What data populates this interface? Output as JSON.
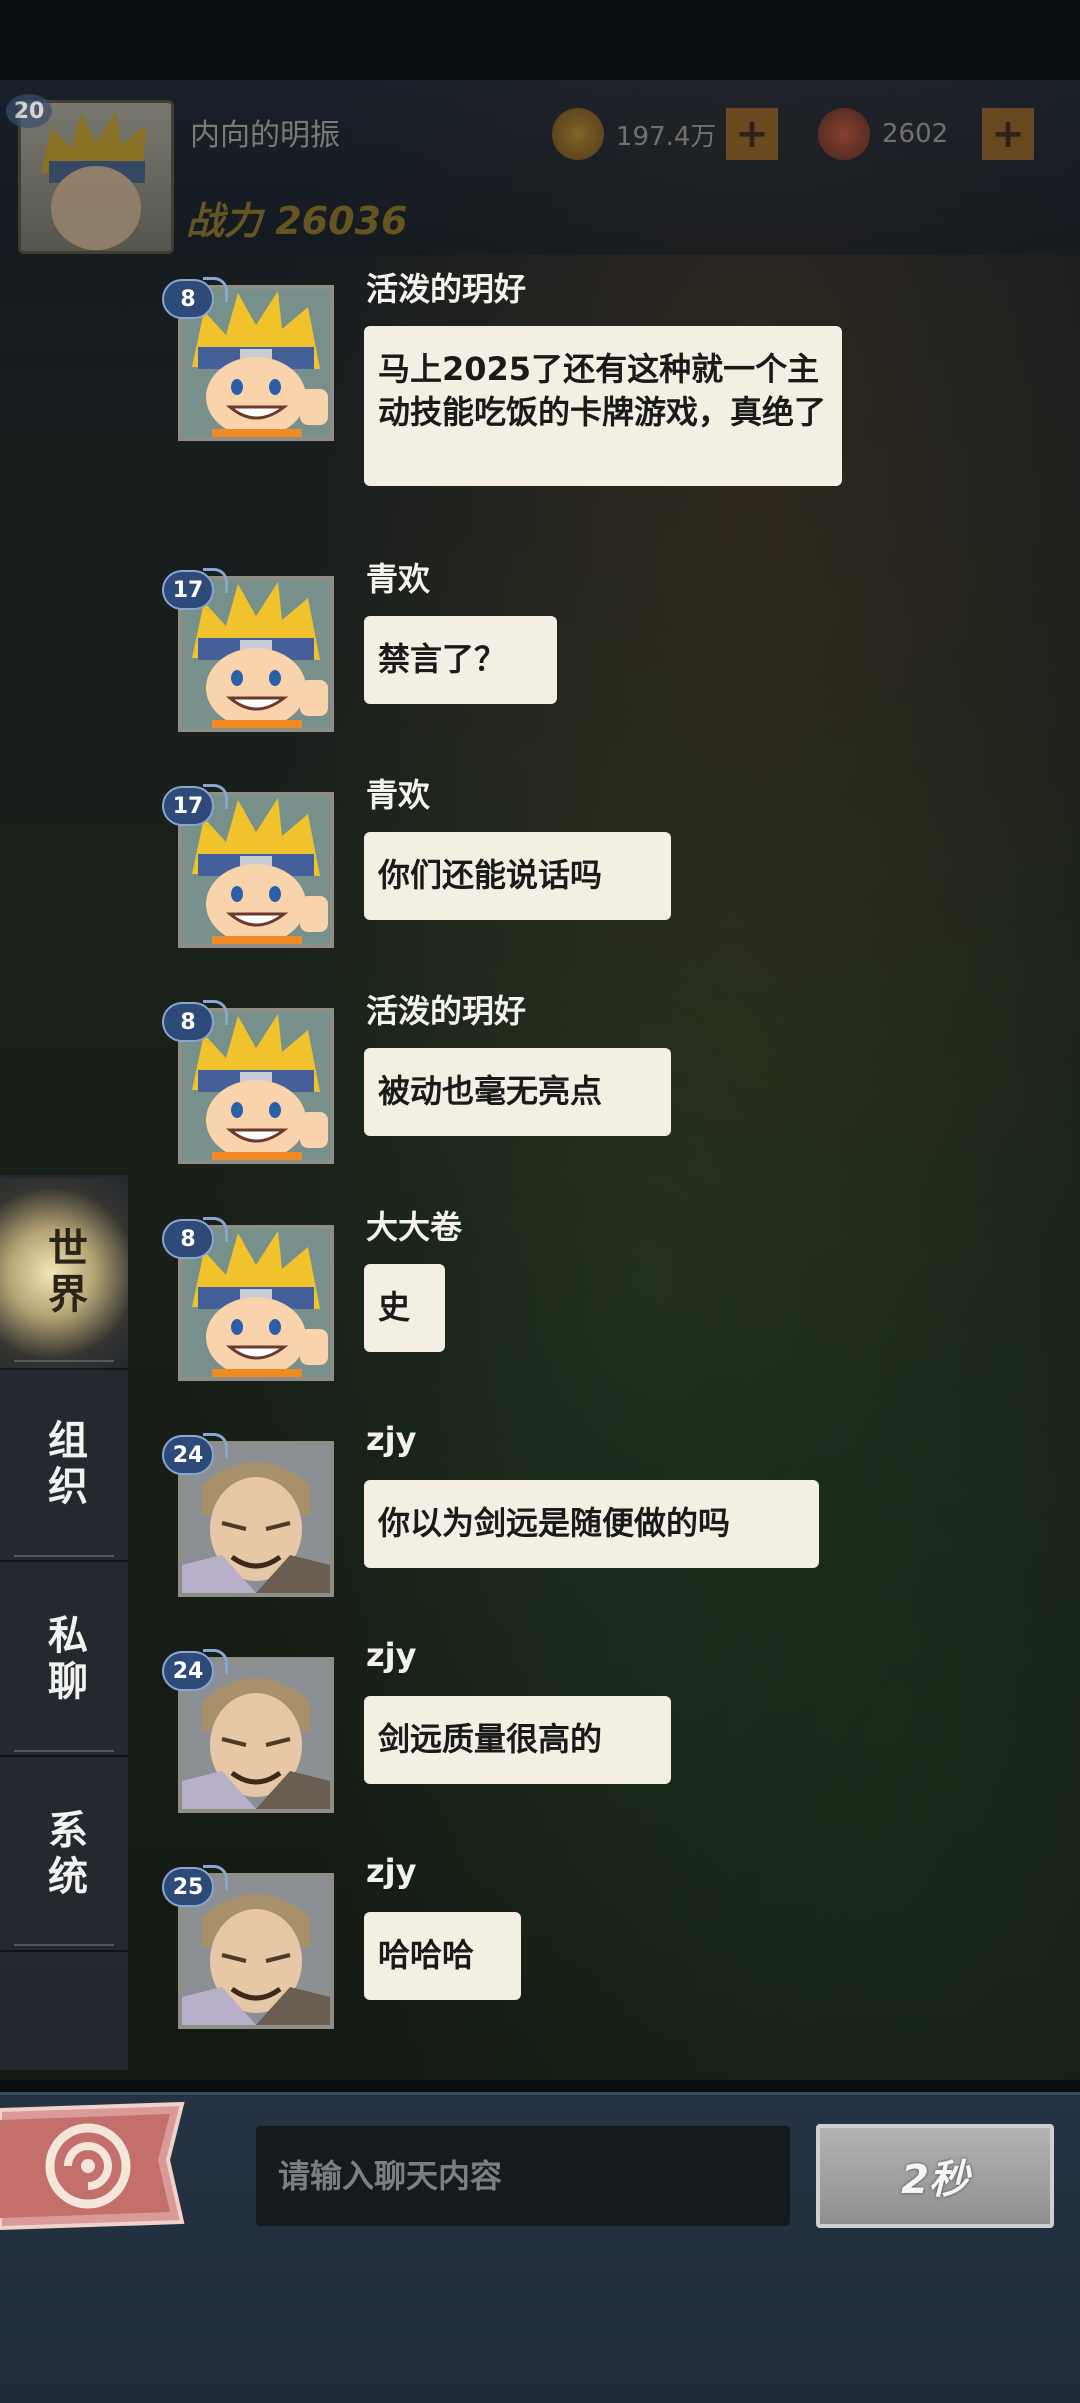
{
  "player": {
    "level": "20",
    "name": "内向的明振",
    "power": "战力 26036",
    "gold": "197.4万",
    "gems": "2602"
  },
  "tabs": [
    {
      "label": "世界",
      "active": true
    },
    {
      "label": "组织",
      "active": false
    },
    {
      "label": "私聊",
      "active": false
    },
    {
      "label": "系统",
      "active": false
    }
  ],
  "messages": [
    {
      "level": "8",
      "name": "活泼的玥好",
      "avatar": "naruto-avatar",
      "text": "马上2025了还有这种就一个主动技能吃饭的卡牌游戏，真绝了"
    },
    {
      "level": "17",
      "name": "青欢",
      "avatar": "naruto-avatar",
      "text": "禁言了？"
    },
    {
      "level": "17",
      "name": "青欢",
      "avatar": "naruto-avatar",
      "text": "你们还能说话吗"
    },
    {
      "level": "8",
      "name": "活泼的玥好",
      "avatar": "naruto-avatar",
      "text": "被动也毫无亮点"
    },
    {
      "level": "8",
      "name": "大大卷",
      "avatar": "naruto-avatar",
      "text": "史"
    },
    {
      "level": "24",
      "name": "zjy",
      "avatar": "old-man-avatar",
      "text": "你以为剑远是随便做的吗"
    },
    {
      "level": "24",
      "name": "zjy",
      "avatar": "old-man-avatar",
      "text": "剑远质量很高的"
    },
    {
      "level": "25",
      "name": "zjy",
      "avatar": "old-man-avatar",
      "text": "哈哈哈"
    }
  ],
  "input": {
    "placeholder": "请输入聊天内容",
    "value": ""
  },
  "send": {
    "label": "2秒"
  },
  "colors": {
    "bubble": "#f3efe2",
    "level_badge": "#2e4a78",
    "active_tab_glow": "#f0e2b0"
  }
}
